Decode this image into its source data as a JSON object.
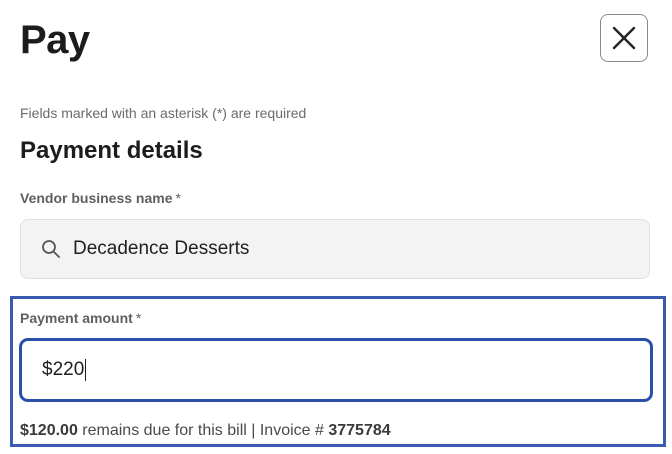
{
  "dialog": {
    "title": "Pay",
    "close_icon": "close-icon",
    "required_note": "Fields marked with an asterisk (*) are required"
  },
  "payment_details": {
    "heading": "Payment details",
    "vendor": {
      "label": "Vendor business name",
      "required_mark": "*",
      "icon": "search-icon",
      "value": "Decadence Desserts"
    },
    "amount": {
      "label": "Payment amount",
      "required_mark": "*",
      "value": "$220"
    },
    "balance": {
      "remaining_amount": "$120.00",
      "remaining_text": "remains due for this bill | Invoice #",
      "invoice_number": "3775784"
    }
  },
  "colors": {
    "highlight_border": "#3a5bb0",
    "focus_border": "#2a4fa8",
    "field_background": "#f3f3f3"
  }
}
